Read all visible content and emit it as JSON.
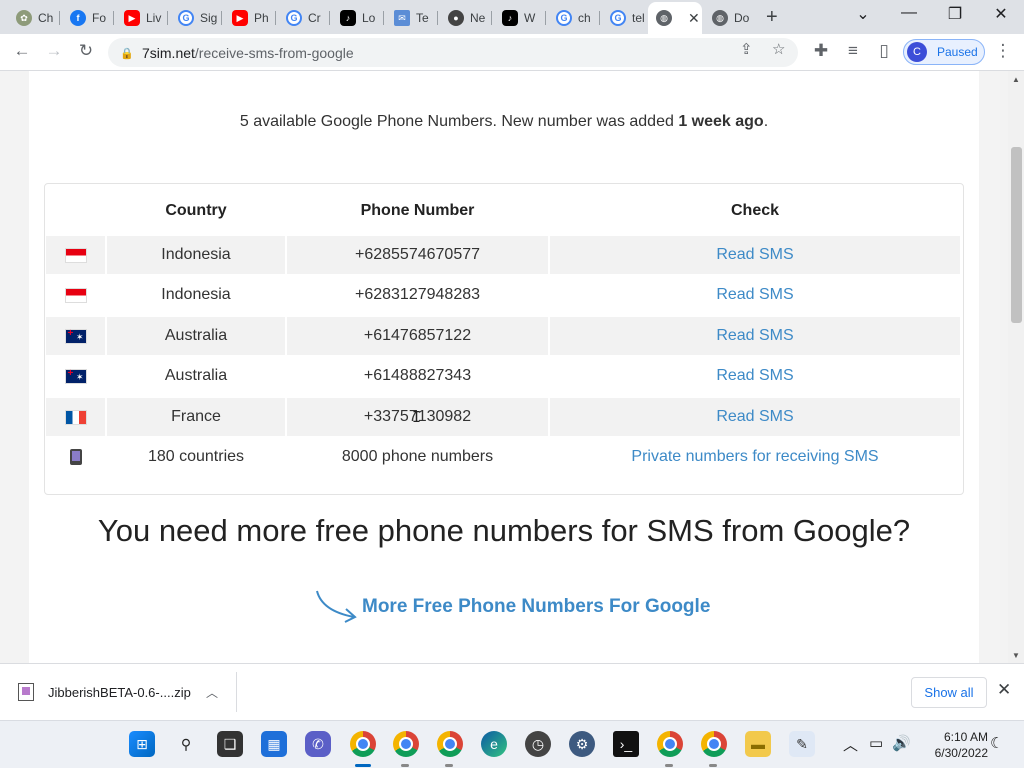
{
  "browser": {
    "tabs": [
      {
        "label": "Ch",
        "icon": "chrome-ext-icon",
        "color": "#8e9b7a"
      },
      {
        "label": "Fo",
        "icon": "facebook-icon",
        "color": "#1877f2"
      },
      {
        "label": "Liv",
        "icon": "youtube-icon",
        "color": "#ff0000"
      },
      {
        "label": "Sig",
        "icon": "google-icon",
        "color": "#4285f4"
      },
      {
        "label": "Ph",
        "icon": "youtube-icon",
        "color": "#ff0000"
      },
      {
        "label": "Cr",
        "icon": "google-icon",
        "color": "#4285f4"
      },
      {
        "label": "Lo",
        "icon": "tiktok-icon",
        "color": "#000000"
      },
      {
        "label": "Te",
        "icon": "mail-icon",
        "color": "#5b8dd6"
      },
      {
        "label": "Ne",
        "icon": "github-icon",
        "color": "#444444"
      },
      {
        "label": "W",
        "icon": "tiktok-icon",
        "color": "#000000"
      },
      {
        "label": "ch",
        "icon": "google-icon",
        "color": "#4285f4"
      },
      {
        "label": "tel",
        "icon": "google-icon",
        "color": "#4285f4"
      },
      {
        "label": "",
        "icon": "globe-icon",
        "color": "#5f6368",
        "active": true
      },
      {
        "label": "Do",
        "icon": "globe-icon",
        "color": "#5f6368"
      }
    ],
    "url_host": "7sim.net",
    "url_path": "/receive-sms-from-google",
    "profile_initial": "C",
    "profile_status": "Paused"
  },
  "page": {
    "availability_prefix": "5 available Google Phone Numbers. New number was added ",
    "availability_bold": "1 week ago",
    "availability_suffix": ".",
    "headers": {
      "country": "Country",
      "phone": "Phone Number",
      "check": "Check"
    },
    "rows": [
      {
        "flag": "indonesia-flag",
        "country": "Indonesia",
        "number": "+6285574670577",
        "check": "Read SMS"
      },
      {
        "flag": "indonesia-flag",
        "country": "Indonesia",
        "number": "+6283127948283",
        "check": "Read SMS"
      },
      {
        "flag": "australia-flag",
        "country": "Australia",
        "number": "+61476857122",
        "check": "Read SMS"
      },
      {
        "flag": "australia-flag",
        "country": "Australia",
        "number": "+61488827343",
        "check": "Read SMS"
      },
      {
        "flag": "france-flag",
        "country": "France",
        "number": "+33757130982",
        "check": "Read SMS"
      }
    ],
    "private_row": {
      "countries": "180 countries",
      "numbers": "8000 phone numbers",
      "link": "Private numbers for receiving SMS"
    },
    "more_heading": "You need more free phone numbers for SMS from Google?",
    "more_link": "More Free Phone Numbers For Google",
    "link_color": "#3d8ac7"
  },
  "downloads": {
    "filename": "JibberishBETA-0.6-....zip",
    "show_all": "Show all"
  },
  "taskbar": {
    "time": "6:10 AM",
    "date": "6/30/2022"
  }
}
